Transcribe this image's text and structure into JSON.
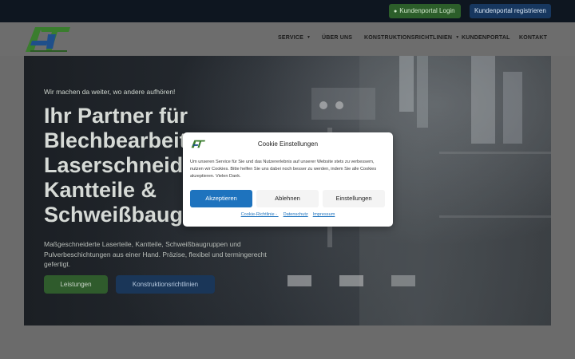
{
  "topbar": {
    "login_label": "Kundenportal Login",
    "login_icon": "user-icon",
    "register_label": "Kundenportal registrieren"
  },
  "header": {
    "logo_name": "amt-logo",
    "nav": [
      {
        "label": "SERVICE",
        "has_dropdown": true
      },
      {
        "label": "ÜBER UNS",
        "has_dropdown": false
      },
      {
        "label": "KONSTRUKTIONSRICHTLINIEN",
        "has_dropdown": true
      },
      {
        "label": "KUNDENPORTAL",
        "has_dropdown": false
      },
      {
        "label": "KONTAKT",
        "has_dropdown": false
      }
    ]
  },
  "hero": {
    "kicker": "Wir machen da weiter, wo andere aufhören!",
    "title_lines": [
      "Ihr Partner für",
      "Blechbearbeitung,",
      "Laserschneiden,",
      "Kantteile &",
      "Schweißbaugruppen"
    ],
    "description": "Maßgeschneiderte Laserteile, Kantteile, Schweißbaugruppen und Pulverbeschichtungen aus einer Hand. Präzise, flexibel und termingerecht gefertigt.",
    "button_services": "Leistungen",
    "button_guidelines": "Konstruktionsrichtlinien"
  },
  "cookie_modal": {
    "title": "Cookie Einstellungen",
    "text": "Um unseren Service für Sie und das Nutzererlebnis auf unserer Website stets zu verbessern, nutzen wir Cookies. Bitte helfen Sie uns dabei noch besser zu werden, indem Sie alle Cookies akzeptieren. Vielen Dank.",
    "accept_label": "Akzeptieren",
    "decline_label": "Ablehnen",
    "settings_label": "Einstellungen",
    "links": [
      "Cookie-Richtlinie - ",
      "Datenschutz",
      "Impressum"
    ]
  },
  "colors": {
    "brand_green": "#2f5b2c",
    "brand_blue": "#1a3658",
    "accept_blue": "#1e73be",
    "topbar_bg": "#0e1620"
  }
}
